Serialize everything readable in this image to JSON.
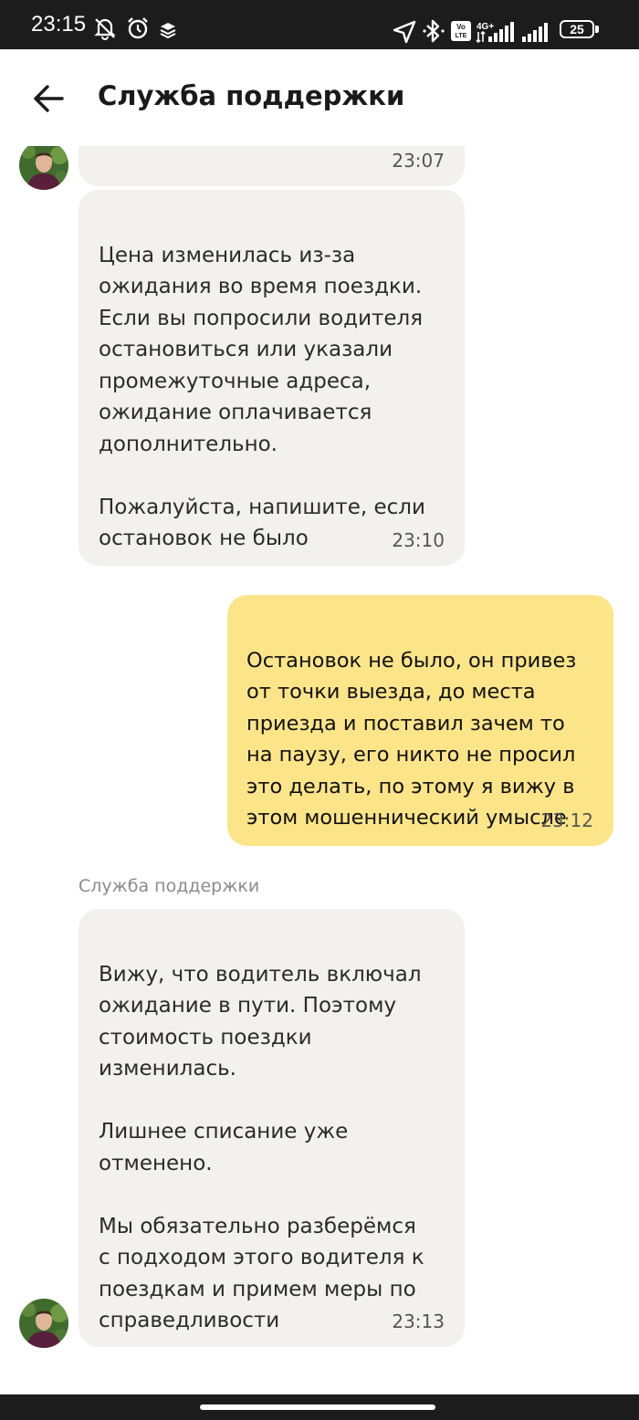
{
  "status_bar": {
    "time": "23:15",
    "battery_level": "25",
    "network_label": "4G+",
    "volte_label": "Vo LTE",
    "icons": [
      "mute-vibrate-icon",
      "alarm-icon",
      "layers-icon",
      "location-arrow-icon",
      "bluetooth-icon",
      "volte-icon",
      "signal-icon",
      "signal-icon",
      "battery-icon"
    ]
  },
  "header": {
    "title": "Служба поддержки",
    "back_icon": "arrow-left-icon"
  },
  "messages": [
    {
      "direction": "incoming",
      "text": "",
      "time": "23:07"
    },
    {
      "direction": "incoming",
      "text": "Цена изменилась из-за\nожидания во время поездки.\nЕсли вы попросили водителя\nостановиться или указали\nпромежуточные адреса,\nожидание оплачивается\nдополнительно.\n\nПожалуйста, напишите, если\nостановок не было",
      "time": "23:10"
    },
    {
      "direction": "outgoing",
      "text": "Остановок не было, он привез\nот точки выезда, до места\nприезда и поставил зачем то\nна паузу, его никто не просил\nэто делать, по этому я вижу в\nэтом мошеннический умысле",
      "time": "23:12"
    },
    {
      "direction": "incoming",
      "sender": "Служба поддержки",
      "text": "Вижу, что водитель включал\nожидание в пути. Поэтому\nстоимость поездки\nизменилась.\n\nЛишнее списание уже\nотменено.\n\nМы обязательно разберёмся\nс подходом этого водителя к\nпоездкам и примем меры по\nсправедливости",
      "time": "23:13"
    }
  ],
  "colors": {
    "incoming_bubble": "#f2f1ef",
    "outgoing_bubble": "#fce588",
    "status_bar_bg": "#1c1c1c",
    "sender_name": "#8c8c8c"
  }
}
